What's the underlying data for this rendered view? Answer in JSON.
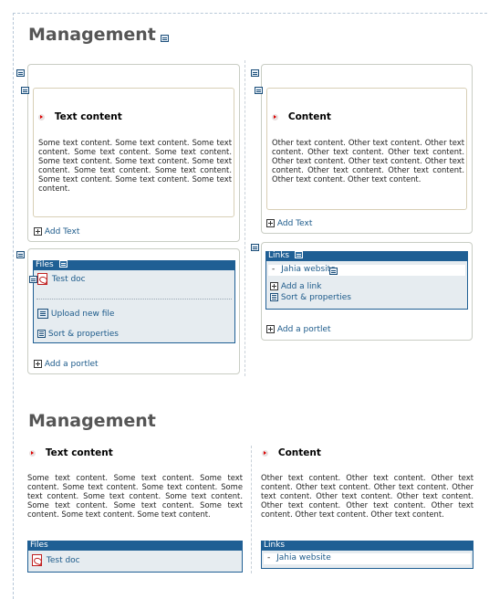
{
  "edit": {
    "heading": "Management",
    "left_content": {
      "title": "Text content",
      "body": "Some text content. Some text content. Some text content. Some text content. Some text content. Some text content. Some text content. Some text content. Some text content. Some text content. Some text content. Some text content. Some text content.",
      "add_label": "Add Text"
    },
    "right_content": {
      "title": "Content",
      "body": "Other text content. Other text content. Other text content. Other text content. Other text content. Other text content. Other text content. Other text content. Other text content. Other text content. Other text content. Other text content.",
      "add_label": "Add Text"
    },
    "files_portlet": {
      "header": "Files",
      "item": "Test doc",
      "upload_label": "Upload new file",
      "sort_label": "Sort & properties"
    },
    "links_portlet": {
      "header": "Links",
      "item_bullet": "-",
      "item": "Jahia website",
      "add_link_label": "Add a link",
      "sort_label": "Sort & properties"
    },
    "left_add_portlet": "Add a portlet",
    "right_add_portlet": "Add a portlet"
  },
  "preview": {
    "heading": "Management",
    "left_title": "Text content",
    "left_body": "Some text content. Some text content. Some text content. Some text content. Some text content. Some text content. Some text content. Some text content. Some text content. Some text content. Some text content. Some text content. Some text content.",
    "right_title": "Content",
    "right_body": "Other text content. Other text content. Other text content. Other text content. Other text content. Other text content. Other text content. Other text content. Other text content. Other text content. Other text content. Other text content. Other text content.",
    "files_header": "Files",
    "files_item": "Test doc",
    "links_header": "Links",
    "links_item_bullet": "-",
    "links_item": "Jahia website"
  },
  "colors": {
    "portlet_header": "#1f5f94",
    "portlet_body": "#e6ecf0",
    "link": "#1c5a8a",
    "heading": "#555555"
  }
}
